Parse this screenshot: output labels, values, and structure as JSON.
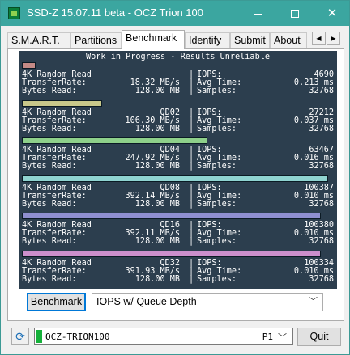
{
  "window": {
    "title": "SSD-Z 15.07.11 beta - OCZ Trion 100",
    "controls": {
      "minimize": "minimize",
      "maximize": "maximize",
      "close": "✕"
    }
  },
  "tabs": [
    {
      "label": "S.M.A.R.T.",
      "active": false
    },
    {
      "label": "Partitions",
      "active": false
    },
    {
      "label": "Benchmark",
      "active": true
    },
    {
      "label": "Identify",
      "active": false
    },
    {
      "label": "Submit",
      "active": false
    },
    {
      "label": "About",
      "active": false
    }
  ],
  "tab_scroll": {
    "left": "◀",
    "right": "▶"
  },
  "console": {
    "header": "Work in Progress - Results Unreliable",
    "colors": {
      "background": "#2c3e4e",
      "text": "#ffffff"
    },
    "blocks": [
      {
        "bar_color": "#c48a86",
        "bar_fraction": 0.045,
        "test": "4K Random Read",
        "qd": "",
        "iops": "4690",
        "transfer": "18.32 MB/s",
        "avg_time": "0.213 ms",
        "bytes": "128.00 MB",
        "samples": "32768"
      },
      {
        "bar_color": "#c8c88a",
        "bar_fraction": 0.261,
        "test": "4K Random Read",
        "qd": "QD02",
        "iops": "27212",
        "transfer": "106.30 MB/s",
        "avg_time": "0.037 ms",
        "bytes": "128.00 MB",
        "samples": "32768"
      },
      {
        "bar_color": "#8ed08a",
        "bar_fraction": 0.605,
        "test": "4K Random Read",
        "qd": "QD04",
        "iops": "63467",
        "transfer": "247.92 MB/s",
        "avg_time": "0.016 ms",
        "bytes": "128.00 MB",
        "samples": "32768"
      },
      {
        "bar_color": "#8fd3d0",
        "bar_fraction": 1.0,
        "test": "4K Random Read",
        "qd": "QD08",
        "iops": "100387",
        "transfer": "392.14 MB/s",
        "avg_time": "0.010 ms",
        "bytes": "128.00 MB",
        "samples": "32768"
      },
      {
        "bar_color": "#8f8fd0",
        "bar_fraction": 0.975,
        "test": "4K Random Read",
        "qd": "QD16",
        "iops": "100380",
        "transfer": "392.11 MB/s",
        "avg_time": "0.010 ms",
        "bytes": "128.00 MB",
        "samples": "32768"
      },
      {
        "bar_color": "#cc8fcc",
        "bar_fraction": 0.975,
        "test": "4K Random Read",
        "qd": "QD32",
        "iops": "100334",
        "transfer": "391.93 MB/s",
        "avg_time": "0.010 ms",
        "bytes": "128.00 MB",
        "samples": "32768"
      }
    ],
    "labels": {
      "transfer": "TransferRate:",
      "bytes": "Bytes Read:",
      "iops": "IOPS:",
      "avg_time": "Avg Time:",
      "samples": "Samples:",
      "sep": "|"
    }
  },
  "controls": {
    "benchmark_button": "Benchmark",
    "mode_select": "IOPS w/ Queue Depth",
    "chevron": "﹀"
  },
  "status": {
    "refresh_icon": "⟳",
    "drive_name": "OCZ-TRION100",
    "partition": "P1",
    "indicator_color": "#16b13b",
    "quit_button": "Quit"
  }
}
